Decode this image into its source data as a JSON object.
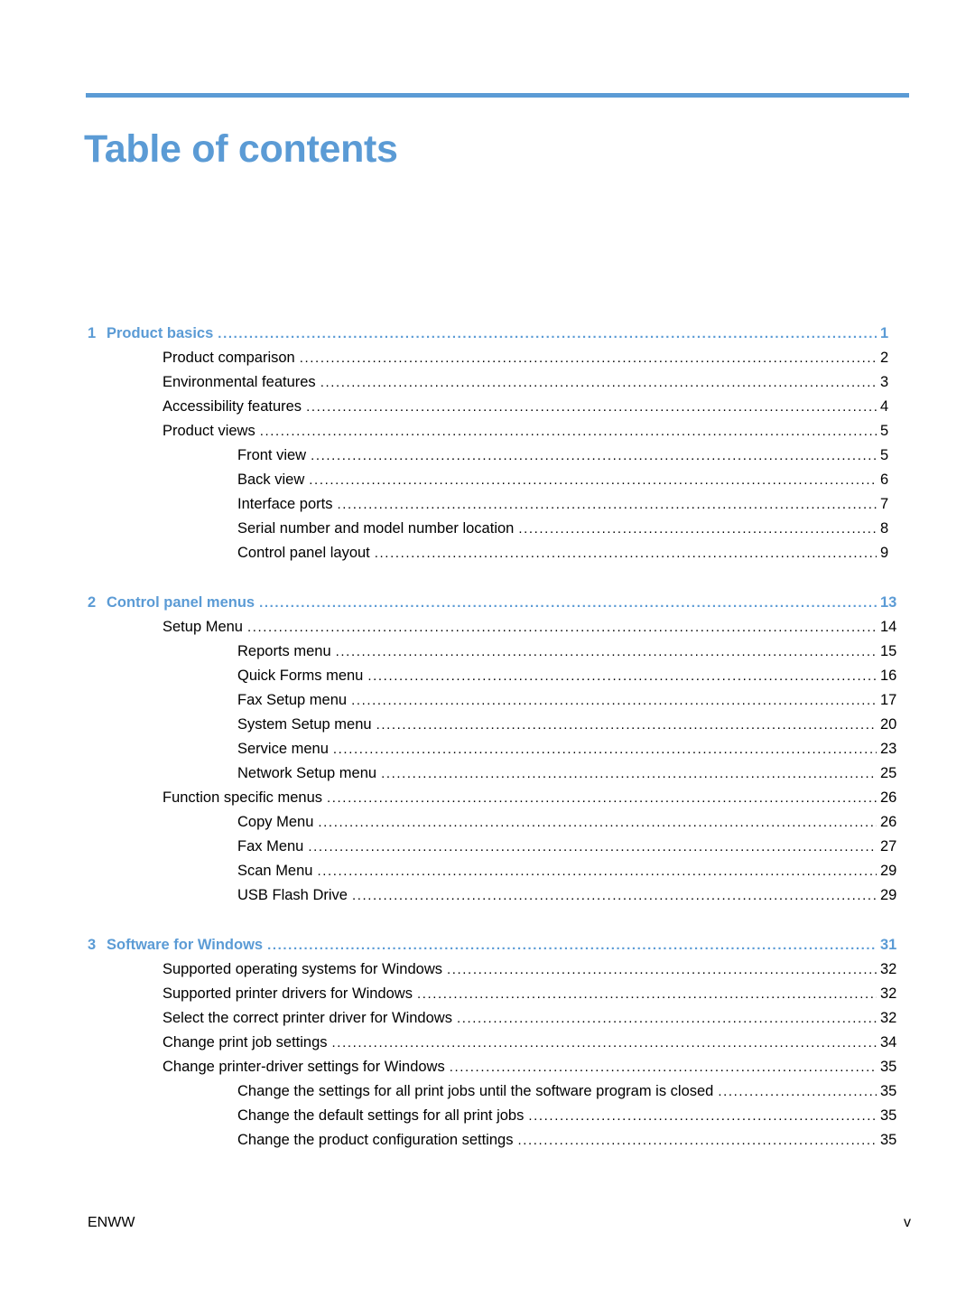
{
  "document": {
    "title": "Table of contents",
    "accent_color": "#5b9bd5",
    "leader_dots": "...................................................................................................................................................................................................................................................."
  },
  "footer": {
    "left": "ENWW",
    "right": "v"
  },
  "toc": {
    "chapters": [
      {
        "number": "1",
        "title": "Product basics",
        "page": "1",
        "entries": [
          {
            "level": 1,
            "label": "Product comparison",
            "page": "2"
          },
          {
            "level": 1,
            "label": "Environmental features",
            "page": "3"
          },
          {
            "level": 1,
            "label": "Accessibility features",
            "page": "4"
          },
          {
            "level": 1,
            "label": "Product views",
            "page": "5"
          },
          {
            "level": 2,
            "label": "Front view",
            "page": "5"
          },
          {
            "level": 2,
            "label": "Back view",
            "page": "6"
          },
          {
            "level": 2,
            "label": "Interface ports",
            "page": "7"
          },
          {
            "level": 2,
            "label": "Serial number and model number location",
            "page": "8"
          },
          {
            "level": 2,
            "label": "Control panel layout",
            "page": "9"
          }
        ]
      },
      {
        "number": "2",
        "title": "Control panel menus",
        "page": "13",
        "entries": [
          {
            "level": 1,
            "label": "Setup Menu",
            "page": "14"
          },
          {
            "level": 2,
            "label": "Reports menu",
            "page": "15"
          },
          {
            "level": 2,
            "label": "Quick Forms menu",
            "page": "16"
          },
          {
            "level": 2,
            "label": "Fax Setup menu",
            "page": "17"
          },
          {
            "level": 2,
            "label": "System Setup menu",
            "page": "20"
          },
          {
            "level": 2,
            "label": "Service menu",
            "page": "23"
          },
          {
            "level": 2,
            "label": "Network Setup menu",
            "page": "25"
          },
          {
            "level": 1,
            "label": "Function specific menus",
            "page": "26"
          },
          {
            "level": 2,
            "label": "Copy Menu",
            "page": "26"
          },
          {
            "level": 2,
            "label": "Fax Menu",
            "page": "27"
          },
          {
            "level": 2,
            "label": "Scan Menu",
            "page": "29"
          },
          {
            "level": 2,
            "label": "USB Flash Drive",
            "page": "29"
          }
        ]
      },
      {
        "number": "3",
        "title": "Software for Windows",
        "page": "31",
        "entries": [
          {
            "level": 1,
            "label": "Supported operating systems for Windows",
            "page": "32"
          },
          {
            "level": 1,
            "label": "Supported printer drivers for Windows",
            "page": "32"
          },
          {
            "level": 1,
            "label": "Select the correct printer driver for Windows",
            "page": "32"
          },
          {
            "level": 1,
            "label": "Change print job settings",
            "page": "34"
          },
          {
            "level": 1,
            "label": "Change printer-driver settings for Windows",
            "page": "35"
          },
          {
            "level": 2,
            "label": "Change the settings for all print jobs until the software program is closed",
            "page": "35"
          },
          {
            "level": 2,
            "label": "Change the default settings for all print jobs",
            "page": "35"
          },
          {
            "level": 2,
            "label": "Change the product configuration settings",
            "page": "35"
          }
        ]
      }
    ]
  }
}
